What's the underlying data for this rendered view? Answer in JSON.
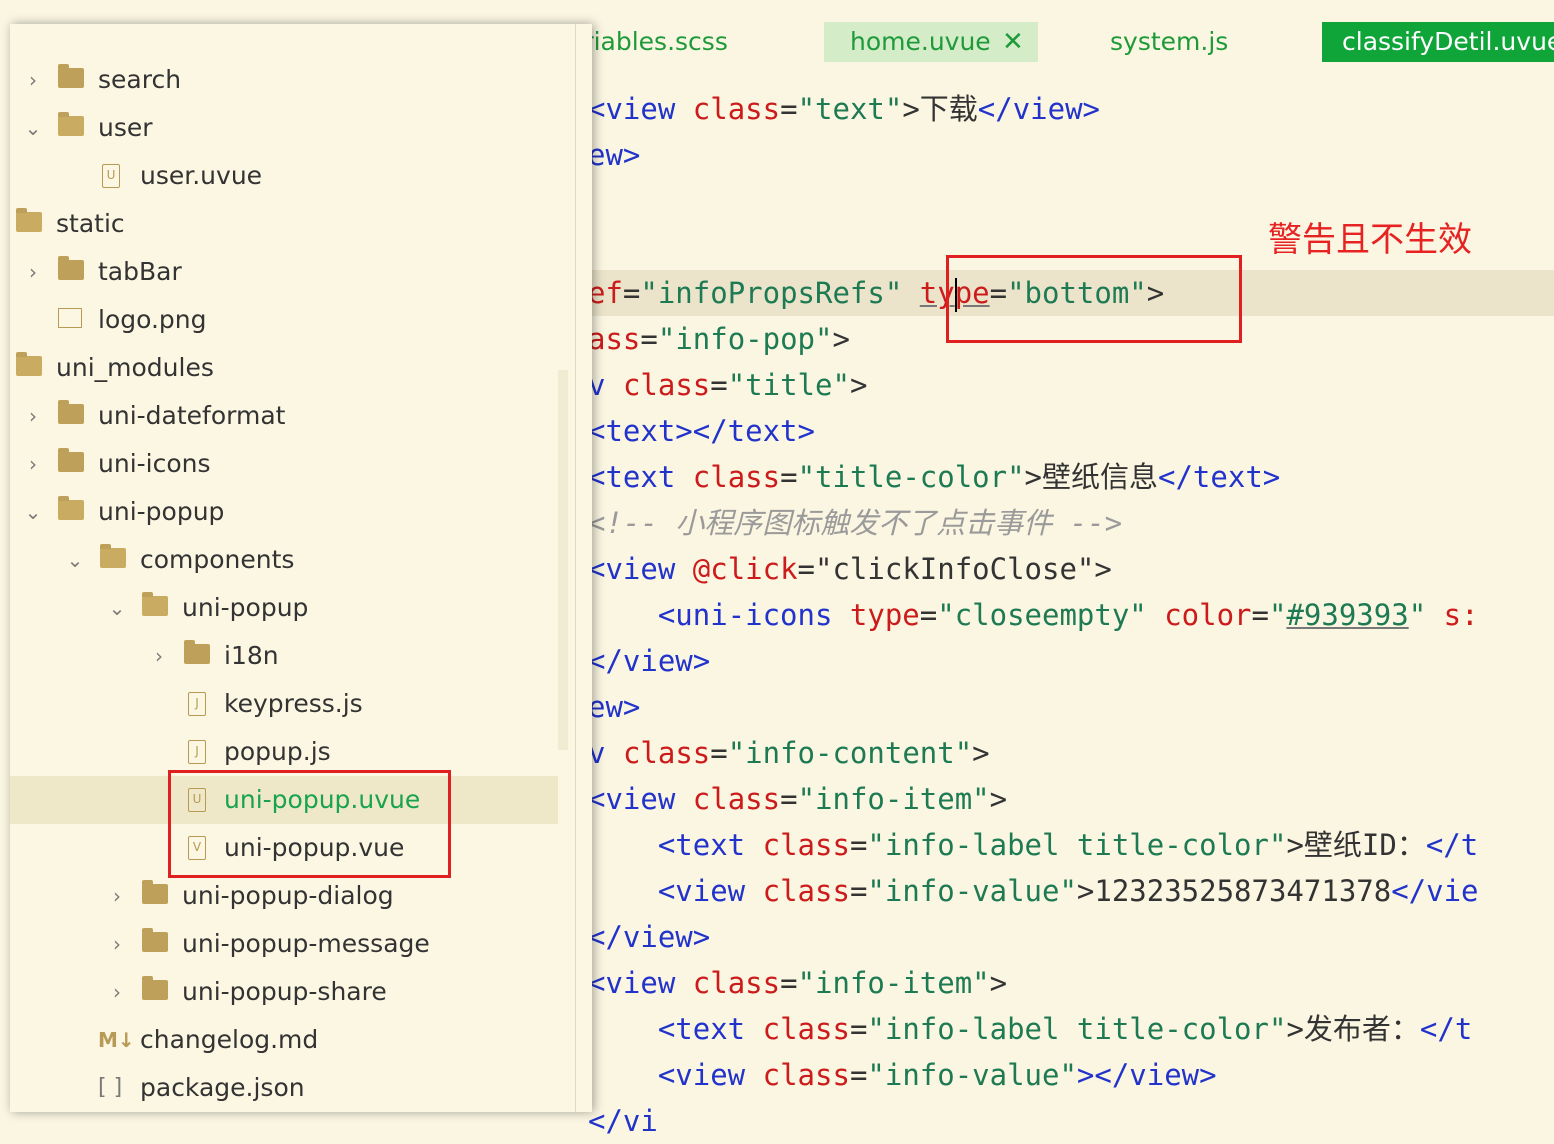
{
  "tabs": [
    {
      "label": "ariables.scss"
    },
    {
      "label": "home.uvue",
      "close": "✕"
    },
    {
      "label": "system.js"
    },
    {
      "label": "classifyDetil.uvue"
    }
  ],
  "annotation": {
    "text": "警告且不生效"
  },
  "code": {
    "l1": [
      "<view",
      "class",
      "=",
      "\"text\"",
      ">下载",
      "</view>"
    ],
    "l2": "ew>",
    "l3": [
      "ef",
      "=",
      "\"infoPropsRefs\"",
      "ty",
      "pe",
      "=",
      "\"bottom\"",
      ">"
    ],
    "l4": [
      "ass",
      "=",
      "\"info-pop\"",
      ">"
    ],
    "l5": [
      "v",
      "class",
      "=",
      "\"title\"",
      ">"
    ],
    "l6": "<text></text>",
    "l7": [
      "<text",
      "class",
      "=",
      "\"title-color\"",
      ">壁纸信息",
      "</text>"
    ],
    "l8": "<!-- 小程序图标触发不了点击事件 -->",
    "l9": [
      "<view",
      "@click",
      "=",
      "\"clickInfoClose\"",
      ">"
    ],
    "l10": [
      "<uni-icons",
      "type",
      "=",
      "\"closeempty\"",
      "color",
      "=",
      "\"",
      "#939393",
      "\"",
      "s:"
    ],
    "l11": "</view>",
    "l12": "ew>",
    "l13": [
      "v",
      "class",
      "=",
      "\"info-content\"",
      ">"
    ],
    "l14": [
      "<view",
      "class",
      "=",
      "\"info-item\"",
      ">"
    ],
    "l15": [
      "<text",
      "class",
      "=",
      "\"info-label title-color\"",
      ">壁纸ID：",
      "</t"
    ],
    "l16": [
      "<view",
      "class",
      "=",
      "\"info-value\"",
      ">12323525873471378",
      "</vie"
    ],
    "l17": "</view>",
    "l18": [
      "<view",
      "class",
      "=",
      "\"info-item\"",
      ">"
    ],
    "l19": [
      "<text",
      "class",
      "=",
      "\"info-label title-color\"",
      ">发布者：",
      "</t"
    ],
    "l20": [
      "<view",
      "class",
      "=",
      "\"info-value\"",
      "></view>"
    ],
    "l21": "</vi"
  },
  "tree": [
    {
      "label": "search",
      "icon": "folder"
    },
    {
      "label": "user",
      "icon": "folder-open"
    },
    {
      "label": "user.uvue",
      "icon": "file-u",
      "glyph": "U"
    },
    {
      "label": "static",
      "icon": "folder-open"
    },
    {
      "label": "tabBar",
      "icon": "folder"
    },
    {
      "label": "logo.png",
      "icon": "image"
    },
    {
      "label": "uni_modules",
      "icon": "folder-open"
    },
    {
      "label": "uni-dateformat",
      "icon": "folder"
    },
    {
      "label": "uni-icons",
      "icon": "folder"
    },
    {
      "label": "uni-popup",
      "icon": "folder-open"
    },
    {
      "label": "components",
      "icon": "folder-open"
    },
    {
      "label": "uni-popup",
      "icon": "folder-open"
    },
    {
      "label": "i18n",
      "icon": "folder"
    },
    {
      "label": "keypress.js",
      "icon": "file-js",
      "glyph": "J"
    },
    {
      "label": "popup.js",
      "icon": "file-js",
      "glyph": "J"
    },
    {
      "label": "uni-popup.uvue",
      "icon": "file-u",
      "glyph": "U"
    },
    {
      "label": "uni-popup.vue",
      "icon": "file-v",
      "glyph": "V"
    },
    {
      "label": "uni-popup-dialog",
      "icon": "folder"
    },
    {
      "label": "uni-popup-message",
      "icon": "folder"
    },
    {
      "label": "uni-popup-share",
      "icon": "folder"
    },
    {
      "label": "changelog.md",
      "icon": "markdown",
      "glyph": "M↓"
    },
    {
      "label": "package.json",
      "icon": "json",
      "glyph": "[ ]"
    }
  ],
  "chev": {
    "right": "›",
    "down": "⌄"
  }
}
